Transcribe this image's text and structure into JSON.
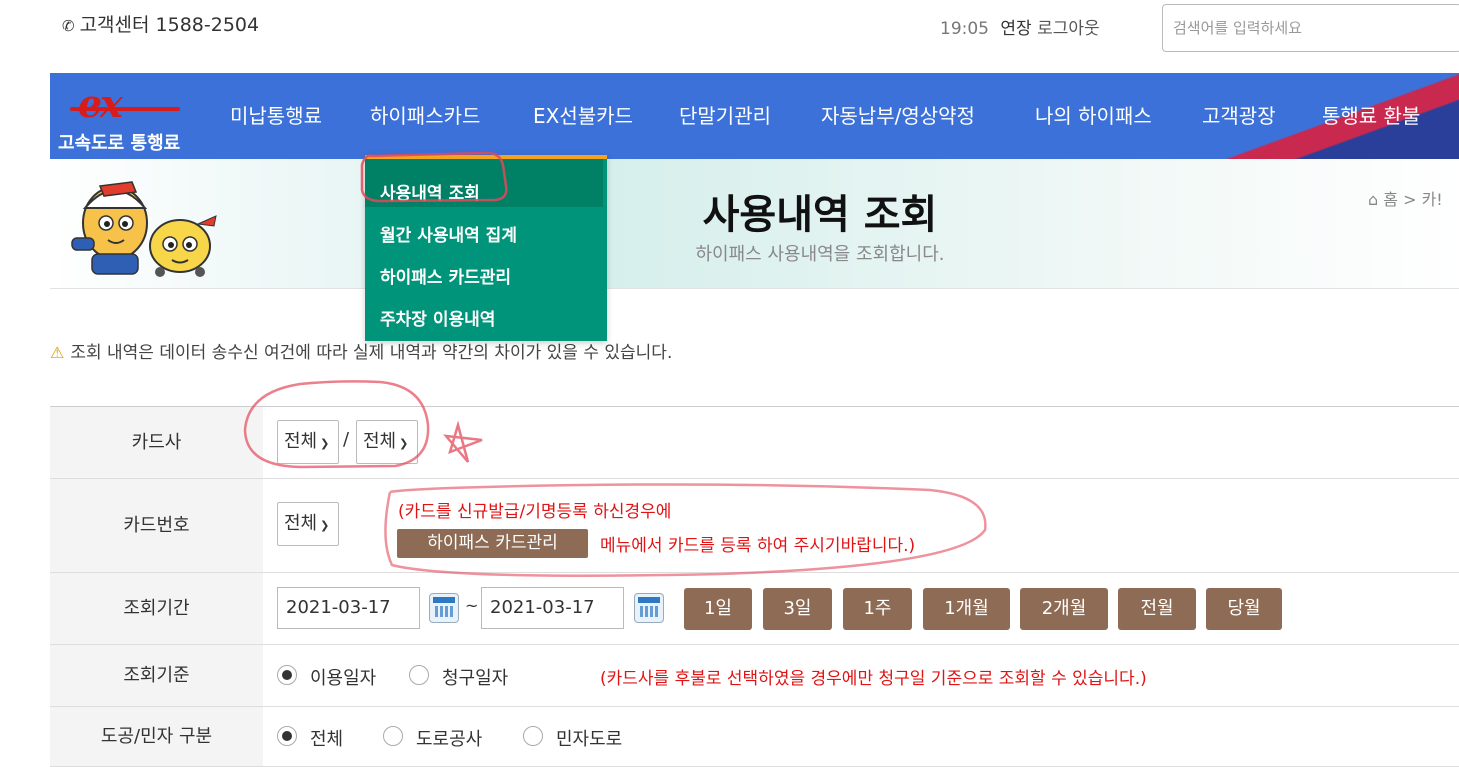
{
  "topbar": {
    "phone_icon": "✆",
    "customer_center": "고객센터 1588-2504",
    "timer": "19:05",
    "extend": "연장",
    "logout": "로그아웃",
    "search_placeholder": "검색어를 입력하세요"
  },
  "logo": {
    "mark": "ex",
    "text": "고속도로 통행료"
  },
  "nav": {
    "items": [
      "미납통행료",
      "하이패스카드",
      "EX선불카드",
      "단말기관리",
      "자동납부/영상약정",
      "나의 하이패스",
      "고객광장",
      "통행료 환불"
    ]
  },
  "dropdown": {
    "items": [
      "사용내역 조회",
      "월간 사용내역 집계",
      "하이패스 카드관리",
      "주차장 이용내역"
    ]
  },
  "page": {
    "title": "사용내역 조회",
    "subtitle": "하이패스 사용내역을 조회합니다.",
    "breadcrumb_home": "홈",
    "breadcrumb_sep": ">",
    "breadcrumb_next": "카!"
  },
  "notice": {
    "icon": "⚠",
    "text": "조회 내역은 데이터 송수신 여건에 따라 실제 내역과 약간의 차이가 있을 수 있습니다."
  },
  "form": {
    "card_company": {
      "label": "카드사",
      "select1": "전체",
      "slash": "/",
      "select2": "전체"
    },
    "card_number": {
      "label": "카드번호",
      "select": "전체",
      "note1": "(카드를 신규발급/기명등록 하신경우에",
      "button": "하이패스 카드관리",
      "note2": "메뉴에서 카드를 등록 하여 주시기바랍니다.)"
    },
    "period": {
      "label": "조회기간",
      "from": "2021-03-17",
      "tilde": "~",
      "to": "2021-03-17",
      "buttons": [
        "1일",
        "3일",
        "1주",
        "1개월",
        "2개월",
        "전월",
        "당월"
      ]
    },
    "basis": {
      "label": "조회기준",
      "options": [
        "이용일자",
        "청구일자"
      ],
      "selected": "이용일자",
      "note": "(카드사를 후불로 선택하였을 경우에만 청구일 기준으로 조회할 수 있습니다.)"
    },
    "road_type": {
      "label": "도공/민자 구분",
      "options": [
        "전체",
        "도로공사",
        "민자도로"
      ],
      "selected": "전체"
    }
  },
  "colors": {
    "nav_blue": "#3b71d8",
    "menu_green": "#00957a",
    "menu_accent": "#f3a31e",
    "button_brown": "#8d6b55",
    "note_red": "#e01414"
  }
}
